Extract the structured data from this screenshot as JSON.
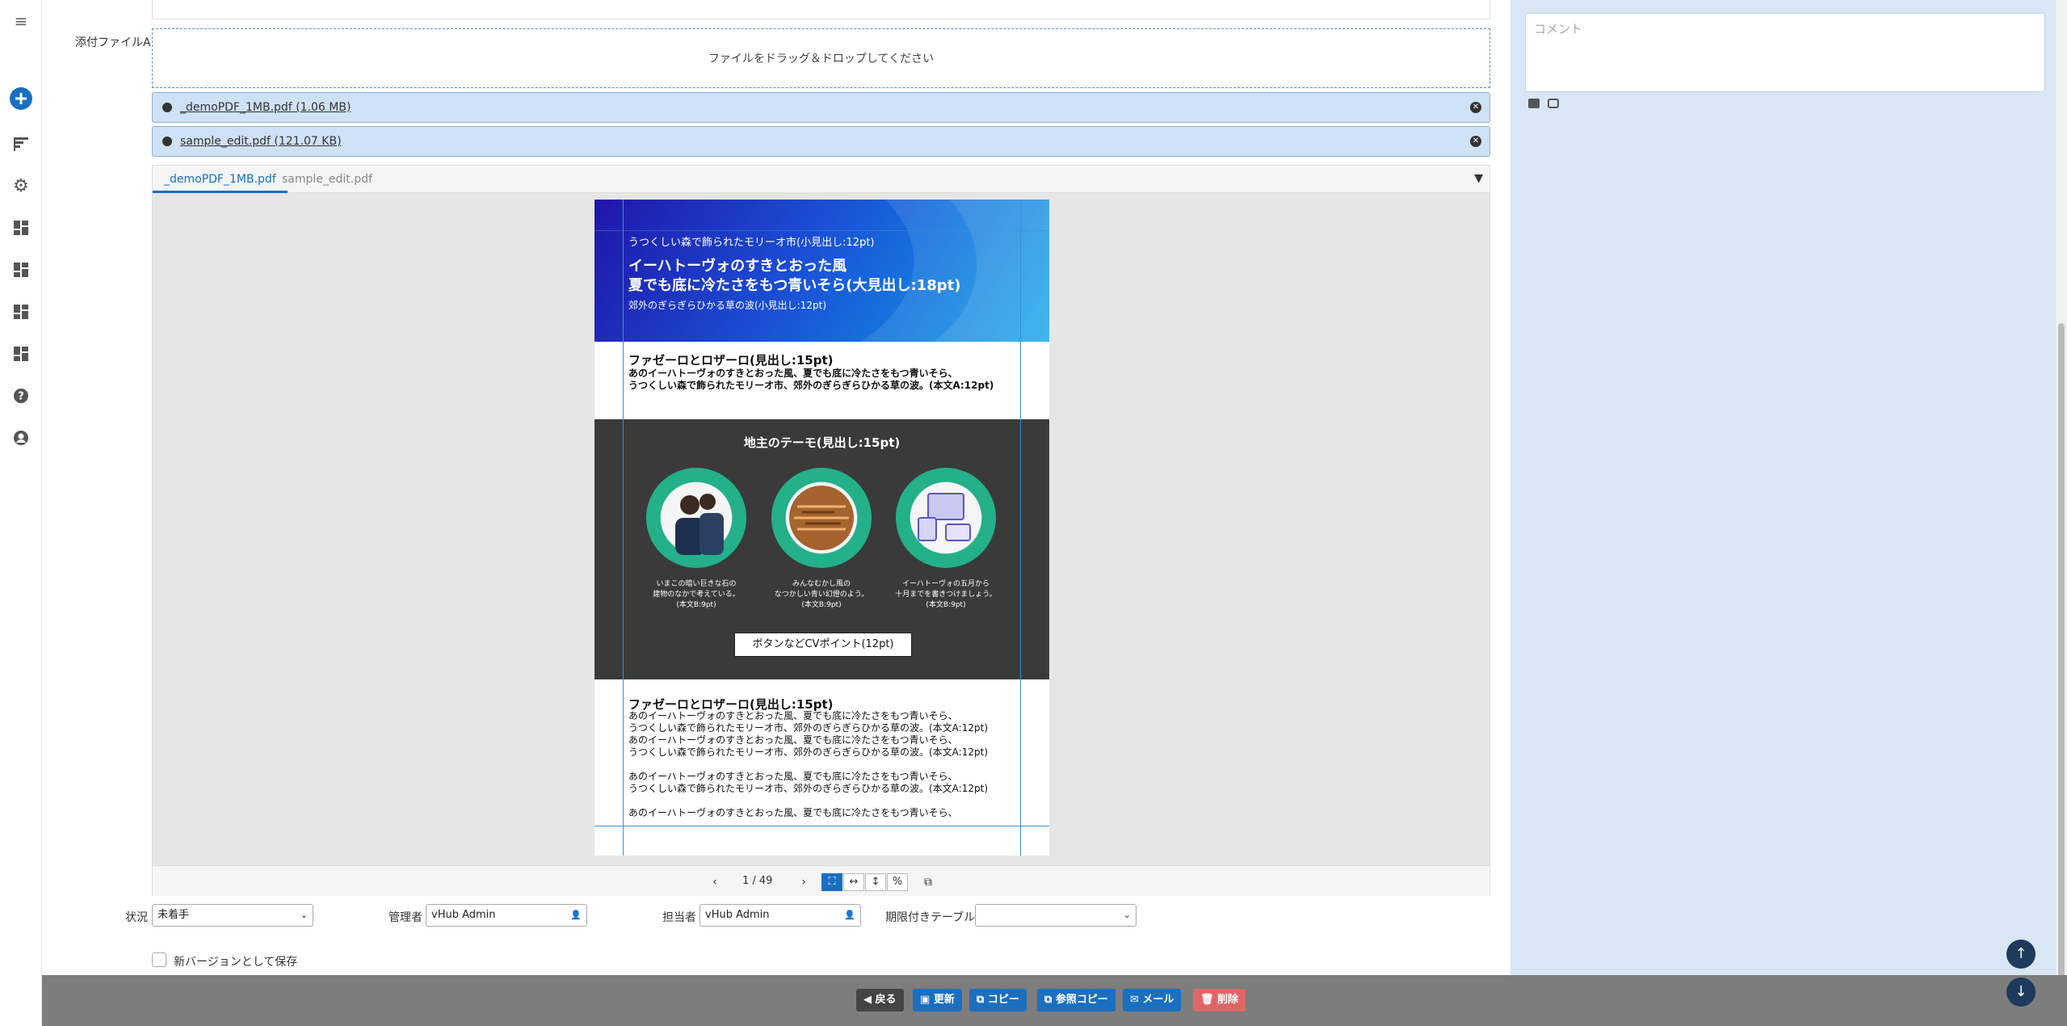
{
  "nav": {
    "icons": [
      "menu-icon",
      "add-icon",
      "gantt-icon",
      "gear-icon",
      "dashboard-icon",
      "dashboard-icon",
      "dashboard-icon",
      "dashboard-icon",
      "help-icon",
      "user-icon"
    ]
  },
  "attachments": {
    "label": "添付ファイルA",
    "dropzone_text": "ファイルをドラッグ＆ドロップしてください",
    "files": [
      {
        "name": "_demoPDF_1MB.pdf",
        "size": "(1.06 MB)"
      },
      {
        "name": "sample_edit.pdf",
        "size": "(121.07 KB)"
      }
    ]
  },
  "viewer": {
    "tabs": [
      "_demoPDF_1MB.pdf",
      "sample_edit.pdf"
    ],
    "active_tab": 0,
    "page_indicator": "1 / 49"
  },
  "pdf": {
    "hero_small": "うつくしい森で飾られたモリーオ市(小見出し:12pt)",
    "hero_big1": "イーハトーヴォのすきとおった風",
    "hero_big2": "夏でも底に冷たさをもつ青いそら(大見出し:18pt)",
    "hero_sub": "郊外のぎらぎらひかる草の波(小見出し:12pt)",
    "sec1_heading": "ファゼーロとロザーロ(見出し:15pt)",
    "sec1_line1": "あのイーハトーヴォのすきとおった風、夏でも底に冷たさをもつ青いそら、",
    "sec1_line2": "うつくしい森で飾られたモリーオ市、郊外のぎらぎらひかる草の波。(本文A:12pt)",
    "theme_heading": "地主のテーモ(見出し:15pt)",
    "captions": [
      [
        "いまこの暗い巨きな石の",
        "建物のなかで考えている。",
        "(本文B:9pt)"
      ],
      [
        "みんなむかし風の",
        "なつかしい青い幻燈のよう。",
        "(本文B:9pt)"
      ],
      [
        "イーハトーヴォの五月から",
        "十月までを書きつけましょう。",
        "(本文B:9pt)"
      ]
    ],
    "cv_button": "ボタンなどCVポイント(12pt)",
    "sec2_heading": "ファゼーロとロザーロ(見出し:15pt)",
    "sec2_lines": [
      "あのイーハトーヴォのすきとおった風、夏でも底に冷たさをもつ青いそら、",
      "うつくしい森で飾られたモリーオ市、郊外のぎらぎらひかる草の波。(本文A:12pt)",
      "あのイーハトーヴォのすきとおった風、夏でも底に冷たさをもつ青いそら、",
      "うつくしい森で飾られたモリーオ市、郊外のぎらぎらひかる草の波。(本文A:12pt)",
      "",
      "あのイーハトーヴォのすきとおった風、夏でも底に冷たさをもつ青いそら、",
      "うつくしい森で飾られたモリーオ市、郊外のぎらぎらひかる草の波。(本文A:12pt)",
      "",
      "あのイーハトーヴォのすきとおった風、夏でも底に冷たさをもつ青いそら、"
    ]
  },
  "fields": {
    "status_label": "状況",
    "status_value": "未着手",
    "manager_label": "管理者",
    "manager_value": "vHub Admin",
    "owner_label": "担当者",
    "owner_value": "vHub Admin",
    "table_label": "期限付きテーブル",
    "table_value": "",
    "save_version_label": "新バージョンとして保存"
  },
  "comment": {
    "placeholder": "コメント"
  },
  "footer": {
    "back": "戻る",
    "update": "更新",
    "copy": "コピー",
    "ref_copy": "参照コピー",
    "mail": "メール",
    "delete": "削除"
  },
  "colors": {
    "accent": "#1a6fc0",
    "panel": "#d8e6f5",
    "footer": "#7d7d7d",
    "delete": "#e06666"
  }
}
